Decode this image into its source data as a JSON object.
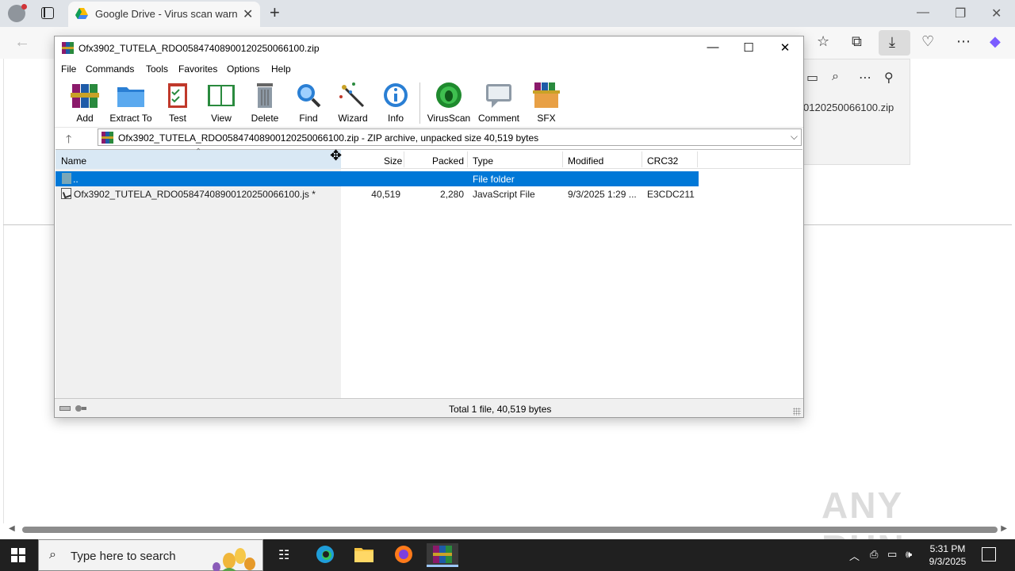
{
  "browser": {
    "tab_title": "Google Drive - Virus scan warning",
    "tab_close": "✕",
    "new_tab": "+",
    "window_controls": [
      "—",
      "❐",
      "✕"
    ],
    "toolbar_icons": [
      "favorites-icon",
      "collections-icon",
      "downloads-icon",
      "browser-essentials-icon",
      "more-icon",
      "copilot-icon"
    ]
  },
  "download_panel": {
    "filename": "0120250066100.zip"
  },
  "winrar": {
    "title": "Ofx3902_TUTELA_RDO05847408900120250066100.zip",
    "window_controls": {
      "minimize": "—",
      "maximize": "☐",
      "close": "✕"
    },
    "menu": [
      "File",
      "Commands",
      "Tools",
      "Favorites",
      "Options",
      "Help"
    ],
    "toolbar": [
      {
        "label": "Add",
        "icon": "add-archive-icon"
      },
      {
        "label": "Extract To",
        "icon": "extract-folder-icon"
      },
      {
        "label": "Test",
        "icon": "test-clipboard-icon"
      },
      {
        "label": "View",
        "icon": "view-book-icon"
      },
      {
        "label": "Delete",
        "icon": "trash-icon"
      },
      {
        "label": "Find",
        "icon": "magnifier-icon"
      },
      {
        "label": "Wizard",
        "icon": "magic-wand-icon"
      },
      {
        "label": "Info",
        "icon": "info-icon"
      },
      {
        "label": "VirusScan",
        "icon": "virus-scan-icon"
      },
      {
        "label": "Comment",
        "icon": "comment-icon"
      },
      {
        "label": "SFX",
        "icon": "sfx-box-icon"
      }
    ],
    "address": "Ofx3902_TUTELA_RDO05847408900120250066100.zip - ZIP archive, unpacked size 40,519 bytes",
    "columns": [
      "Name",
      "Size",
      "Packed",
      "Type",
      "Modified",
      "CRC32"
    ],
    "rows": [
      {
        "name": "..",
        "size": "",
        "packed": "",
        "type": "File folder",
        "modified": "",
        "crc": ""
      },
      {
        "name": "Ofx3902_TUTELA_RDO05847408900120250066100.js *",
        "size": "40,519",
        "packed": "2,280",
        "type": "JavaScript File",
        "modified": "9/3/2025 1:29 ...",
        "crc": "E3CDC211"
      }
    ],
    "status": "Total 1 file, 40,519 bytes"
  },
  "taskbar": {
    "search_placeholder": "Type here to search",
    "time": "5:31 PM",
    "date": "9/3/2025"
  },
  "watermark": "ANY RUN"
}
